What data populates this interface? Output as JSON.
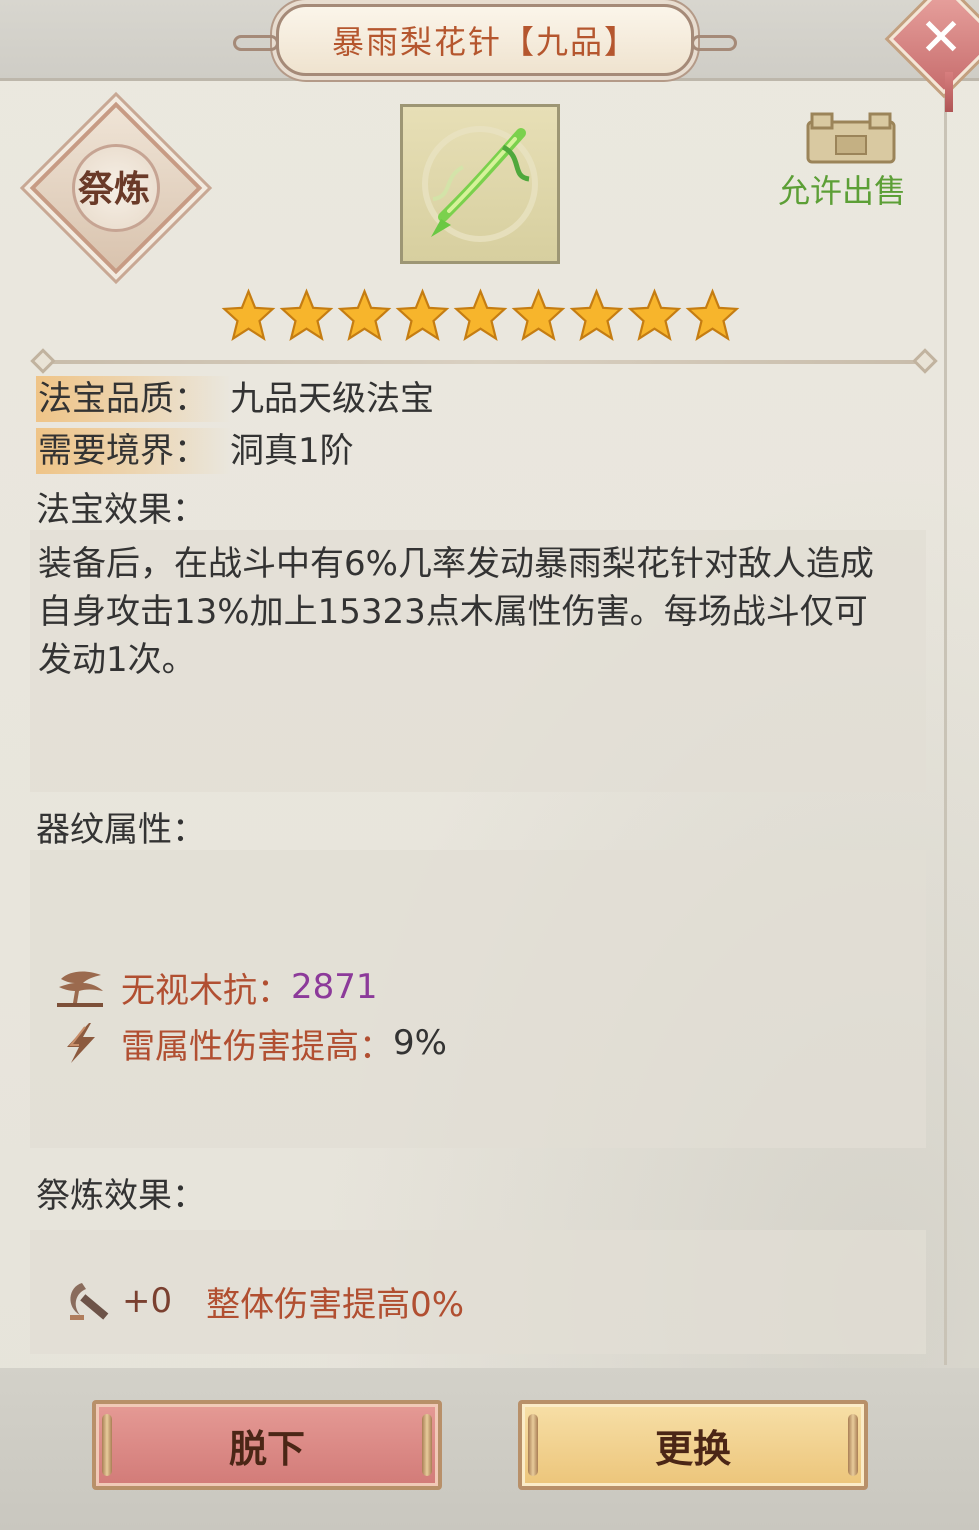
{
  "header": {
    "title": "暴雨梨花针【九品】",
    "close_icon": "close-icon"
  },
  "refine_badge": {
    "label": "祭炼"
  },
  "item": {
    "icon": "needle-weapon-icon",
    "stars": 9
  },
  "sell": {
    "label": "允许出售",
    "icon": "chest-icon"
  },
  "info": {
    "quality_label": "法宝品质：",
    "quality_value": "九品天级法宝",
    "realm_label": "需要境界：",
    "realm_value": "洞真1阶",
    "effect_label": "法宝效果：",
    "effect_text": "装备后，在战斗中有6%几率发动暴雨梨花针对敌人造成自身攻击13%加上15323点木属性伤害。每场战斗仅可发动1次。"
  },
  "pattern_attrs": {
    "label": "器纹属性：",
    "items": [
      {
        "icon": "tree-icon",
        "name": "无视木抗：",
        "value": "2871",
        "color": "#8c3a9a"
      },
      {
        "icon": "lightning-icon",
        "name": "雷属性伤害提高：",
        "value": "9%",
        "color": "#333333"
      }
    ]
  },
  "refine_effect": {
    "label": "祭炼效果：",
    "icon": "refine-hammer-icon",
    "plus": "+0",
    "text": "整体伤害提高0%"
  },
  "buttons": {
    "unequip": "脱下",
    "replace": "更换"
  },
  "colors": {
    "title": "#b5562e",
    "sell": "#5c9f36",
    "attr_name": "#b14f31",
    "unequip_btn": "#d27b78",
    "replace_btn": "#ecc57a"
  }
}
